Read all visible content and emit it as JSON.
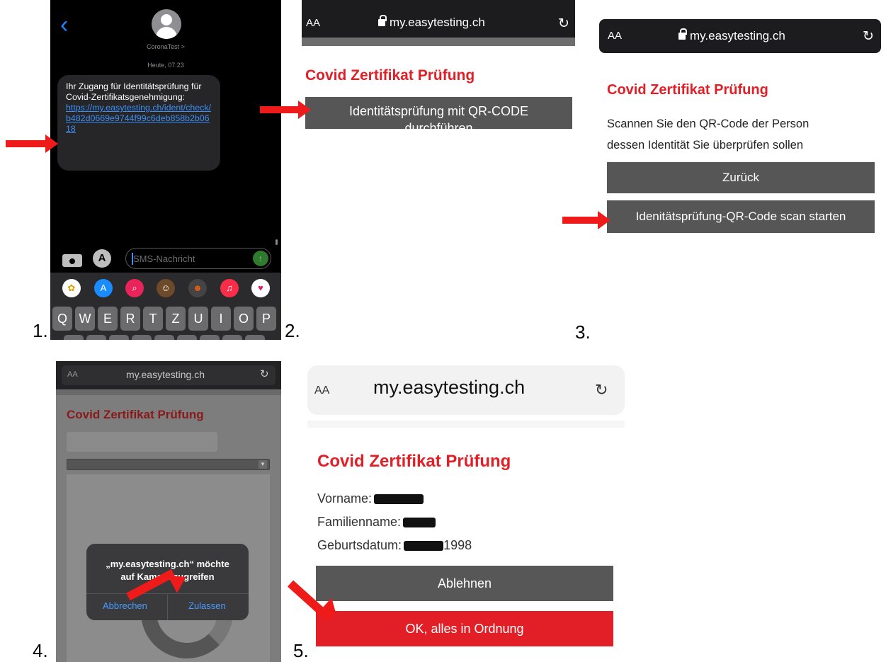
{
  "steps": {
    "s1": "1.",
    "s2": "2.",
    "s3": "3.",
    "s4": "4.",
    "s5": "5."
  },
  "panel1": {
    "back_icon": "chevron-left-icon",
    "contact": "CoronaTest >",
    "timestamp": "Heute, 07:23",
    "message_text": "Ihr Zugang für Identitätsprüfung für Covid-Zertifikatsgenehmigung:",
    "message_link": "https://my.easytesting.ch/ident/check/b482d0669e9744f99c6deb858b2b0618",
    "input_placeholder": "SMS-Nachricht",
    "keyboard_row": [
      "Q",
      "W",
      "E",
      "R",
      "T",
      "Z",
      "U",
      "I",
      "O",
      "P"
    ]
  },
  "browser": {
    "aa_label": "AA",
    "host": "my.easytesting.ch",
    "reload_icon": "reload-icon"
  },
  "panel2": {
    "title": "Covid Zertifikat Prüfung",
    "button_line1": "Identitätsprüfung mit QR-CODE",
    "button_line2": "durchführen"
  },
  "panel3": {
    "title": "Covid Zertifikat Prüfung",
    "instruction_line1": "Scannen Sie den QR-Code der Person",
    "instruction_line2": "dessen Identität Sie überprüfen sollen",
    "back_button": "Zurück",
    "scan_button": "Idenitätsprüfung-QR-Code scan starten"
  },
  "panel4": {
    "title": "Covid Zertifikat Prüfung",
    "dialog_line1": "„my.easytesting.ch“ möchte",
    "dialog_line2": "auf Kamera zugreifen",
    "cancel": "Abbrechen",
    "allow": "Zulassen"
  },
  "panel5": {
    "title": "Covid Zertifikat Prüfung",
    "firstname_label": "Vorname:",
    "lastname_label": "Familienname:",
    "birthdate_label": "Geburtsdatum:",
    "birthdate_year": "1998",
    "reject_button": "Ablehnen",
    "ok_button": "OK, alles in Ordnung"
  },
  "colors": {
    "accent_red": "#e21f26",
    "button_gray": "#565656",
    "link_blue": "#3b8ef5",
    "arrow_red": "#ef1a1a"
  }
}
